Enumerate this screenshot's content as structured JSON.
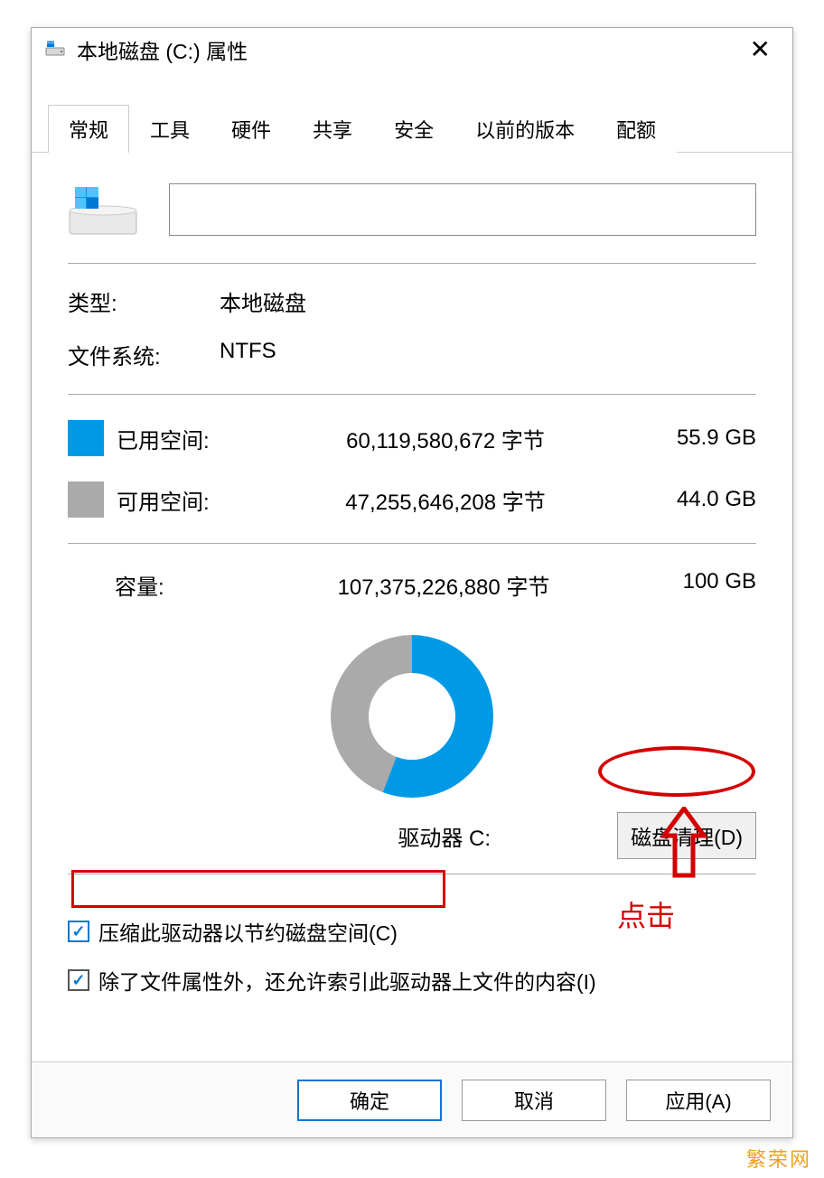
{
  "window": {
    "title": "本地磁盘 (C:) 属性"
  },
  "tabs": [
    "常规",
    "工具",
    "硬件",
    "共享",
    "安全",
    "以前的版本",
    "配额"
  ],
  "activeTab": 0,
  "nameField": {
    "value": ""
  },
  "info": {
    "typeLabel": "类型:",
    "typeValue": "本地磁盘",
    "fsLabel": "文件系统:",
    "fsValue": "NTFS"
  },
  "space": {
    "usedLabel": "已用空间:",
    "usedBytes": "60,119,580,672 字节",
    "usedGB": "55.9 GB",
    "freeLabel": "可用空间:",
    "freeBytes": "47,255,646,208 字节",
    "freeGB": "44.0 GB"
  },
  "capacity": {
    "label": "容量:",
    "bytes": "107,375,226,880 字节",
    "gb": "100 GB"
  },
  "driveLetter": "驱动器 C:",
  "cleanupBtn": "磁盘清理(D)",
  "checks": {
    "compress": "压缩此驱动器以节约磁盘空间(C)",
    "index": "除了文件属性外，还允许索引此驱动器上文件的内容(I)"
  },
  "buttons": {
    "ok": "确定",
    "cancel": "取消",
    "apply": "应用(A)"
  },
  "annotation": {
    "click": "点击"
  },
  "watermark": "繁荣网",
  "chart_data": {
    "type": "pie",
    "title": "驱动器 C:",
    "series": [
      {
        "name": "已用空间",
        "value": 60119580672,
        "display": "55.9 GB",
        "color": "#0099e5"
      },
      {
        "name": "可用空间",
        "value": 47255646208,
        "display": "44.0 GB",
        "color": "#aaaaaa"
      }
    ],
    "total": {
      "value": 107375226880,
      "display": "100 GB"
    }
  }
}
